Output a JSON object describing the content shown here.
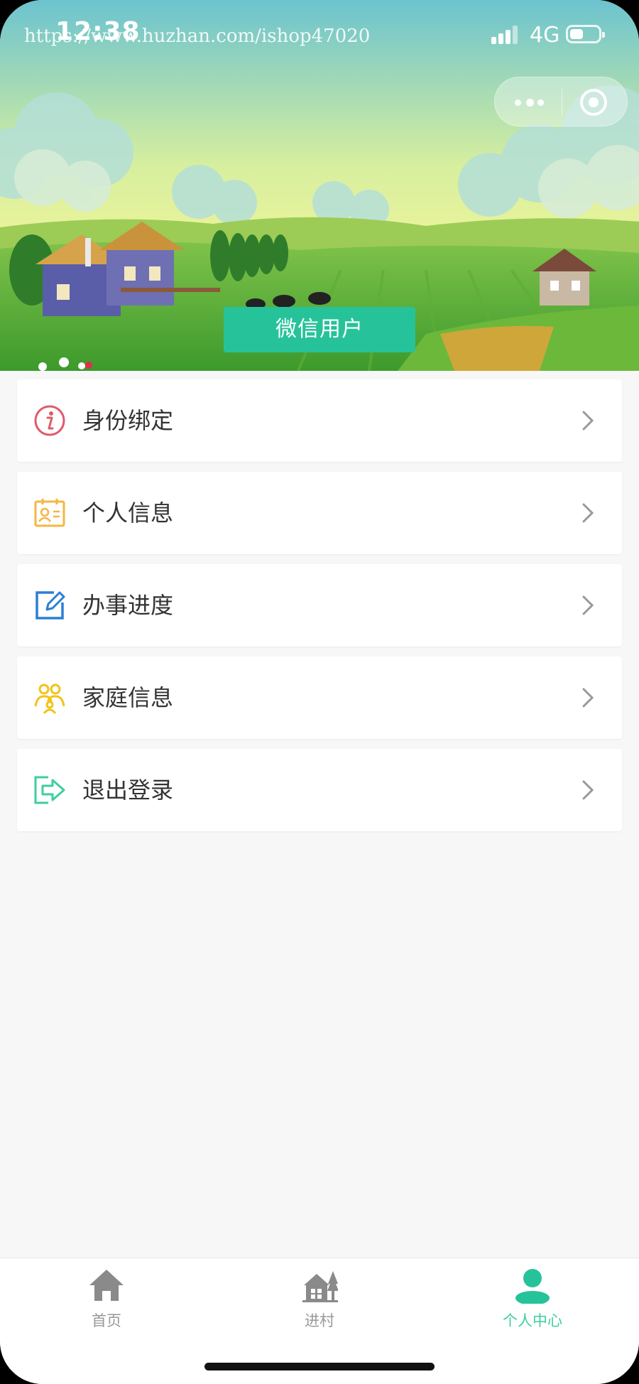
{
  "status_bar": {
    "time": "12:38",
    "watermark": "https://www.huzhan.com/ishop47020",
    "network": "4G"
  },
  "header": {
    "user_name": "微信用户"
  },
  "menu": {
    "items": [
      {
        "label": "身份绑定",
        "icon": "info-icon",
        "color": "#e05a6b"
      },
      {
        "label": "个人信息",
        "icon": "id-card-icon",
        "color": "#f5b642"
      },
      {
        "label": "办事进度",
        "icon": "edit-icon",
        "color": "#2b7fd4"
      },
      {
        "label": "家庭信息",
        "icon": "family-icon",
        "color": "#f2c318"
      },
      {
        "label": "退出登录",
        "icon": "logout-icon",
        "color": "#3dcf9e"
      }
    ]
  },
  "tabbar": {
    "tabs": [
      {
        "label": "首页",
        "icon": "home-icon",
        "active": false
      },
      {
        "label": "进村",
        "icon": "village-icon",
        "active": false
      },
      {
        "label": "个人中心",
        "icon": "user-icon",
        "active": true
      }
    ]
  },
  "colors": {
    "accent": "#26c39a",
    "tab_active": "#3dcf9e",
    "tab_inactive": "#999999"
  }
}
